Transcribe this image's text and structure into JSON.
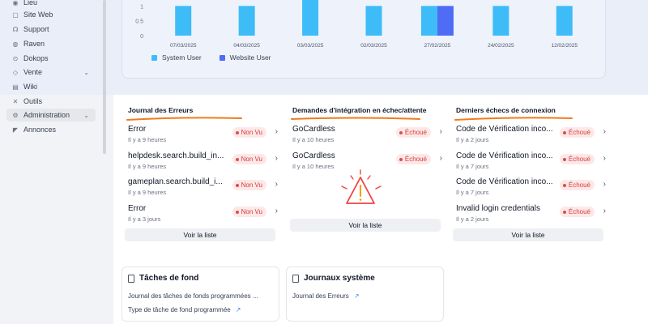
{
  "sidebar": {
    "items": [
      {
        "label": "Lieu",
        "icon": "location-icon"
      },
      {
        "label": "Site Web",
        "icon": "web-icon"
      },
      {
        "label": "Support",
        "icon": "support-icon"
      },
      {
        "label": "Raven",
        "icon": "raven-icon"
      },
      {
        "label": "Dokops",
        "icon": "dokops-icon"
      },
      {
        "label": "Vente",
        "icon": "sales-icon",
        "expandable": true
      },
      {
        "label": "Wiki",
        "icon": "wiki-icon"
      },
      {
        "label": "Outils",
        "icon": "tools-icon"
      },
      {
        "label": "Administration",
        "icon": "admin-icon",
        "expandable": true,
        "active": true
      },
      {
        "label": "Annonces",
        "icon": "announce-icon"
      }
    ]
  },
  "chart_data": {
    "type": "bar",
    "categories": [
      "07/03/2025",
      "04/03/2025",
      "03/03/2025",
      "02/03/2025",
      "27/02/2025",
      "24/02/2025",
      "12/02/2025"
    ],
    "series": [
      {
        "name": "System User",
        "values": [
          1,
          1,
          1.2,
          1,
          1,
          1,
          1
        ],
        "color": "#3ebcf8"
      },
      {
        "name": "Website User",
        "values": [
          0,
          0,
          0,
          0,
          1,
          0,
          0
        ],
        "color": "#4f6cf5"
      }
    ],
    "yticks": [
      "0",
      "0.5",
      "1"
    ],
    "ylim": [
      0,
      1.2
    ],
    "legend": "bottom-left"
  },
  "columns": [
    {
      "title": "Journal des Erreurs",
      "rows": [
        {
          "title": "Error",
          "time": "Il y a 9 heures",
          "badge": "Non Vu"
        },
        {
          "title": "helpdesk.search.build_in...",
          "time": "Il y a 9 heures",
          "badge": "Non Vu"
        },
        {
          "title": "gameplan.search.build_i...",
          "time": "Il y a 9 heures",
          "badge": "Non Vu"
        },
        {
          "title": "Error",
          "time": "Il y a 3 jours",
          "badge": "Non Vu"
        }
      ],
      "button": "Voir la liste"
    },
    {
      "title": "Demandes d'intégration en échec/attente",
      "rows": [
        {
          "title": "GoCardless",
          "time": "Il y a 10 heures",
          "badge": "Échoué"
        },
        {
          "title": "GoCardless",
          "time": "Il y a 10 heures",
          "badge": "Échoué"
        }
      ],
      "button": "Voir la liste"
    },
    {
      "title": "Derniers échecs de connexion",
      "rows": [
        {
          "title": "Code de Vérification inco...",
          "time": "Il y a 2 jours",
          "badge": "Échoué"
        },
        {
          "title": "Code de Vérification inco...",
          "time": "Il y a 7 jours",
          "badge": "Échoué"
        },
        {
          "title": "Code de Vérification inco...",
          "time": "Il y a 7 jours",
          "badge": "Échoué"
        },
        {
          "title": "Invalid login credentials",
          "time": "Il y a 2 jours",
          "badge": "Échoué"
        }
      ],
      "button": "Voir la liste"
    }
  ],
  "bottom_cards": [
    {
      "title": "Tâches de fond",
      "links": [
        "Journal des tâches de fonds programmées ...",
        "Type de tâche de fond programmée"
      ]
    },
    {
      "title": "Journaux système",
      "links": [
        "Journal des Erreurs"
      ]
    }
  ],
  "colors": {
    "accent_underline": "#f07c1c",
    "badge_bg": "#fde8e8",
    "badge_text": "#d43d3d",
    "warning": "#ef4444"
  }
}
